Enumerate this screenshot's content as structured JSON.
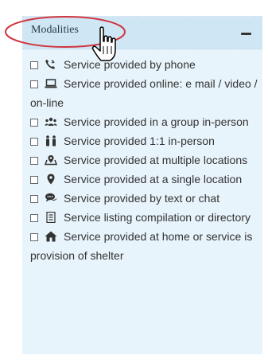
{
  "panel": {
    "title": "Modalities",
    "collapse_glyph": "minus-icon",
    "items": [
      {
        "label": "Service provided by phone",
        "icon": "phone-icon",
        "checked": false
      },
      {
        "label": "Service provided online: e mail / video / on-line",
        "icon": "laptop-icon",
        "checked": false
      },
      {
        "label": "Service provided in a group in-person",
        "icon": "group-icon",
        "checked": false
      },
      {
        "label": "Service provided 1:1 in-person",
        "icon": "two-persons-icon",
        "checked": false
      },
      {
        "label": "Service provided at multiple locations",
        "icon": "multiple-locations-icon",
        "checked": false
      },
      {
        "label": "Service provided at a single location",
        "icon": "map-marker-icon",
        "checked": false
      },
      {
        "label": "Service provided by text or chat",
        "icon": "chat-icon",
        "checked": false
      },
      {
        "label": "Service listing compilation or directory",
        "icon": "list-document-icon",
        "checked": false
      },
      {
        "label": "Service provided at home or service is provision of shelter",
        "icon": "home-icon",
        "checked": false
      }
    ]
  },
  "colors": {
    "panel_bg": "#e8f4fb",
    "header_bg": "#cfe6f5",
    "highlight": "#d0353f"
  }
}
